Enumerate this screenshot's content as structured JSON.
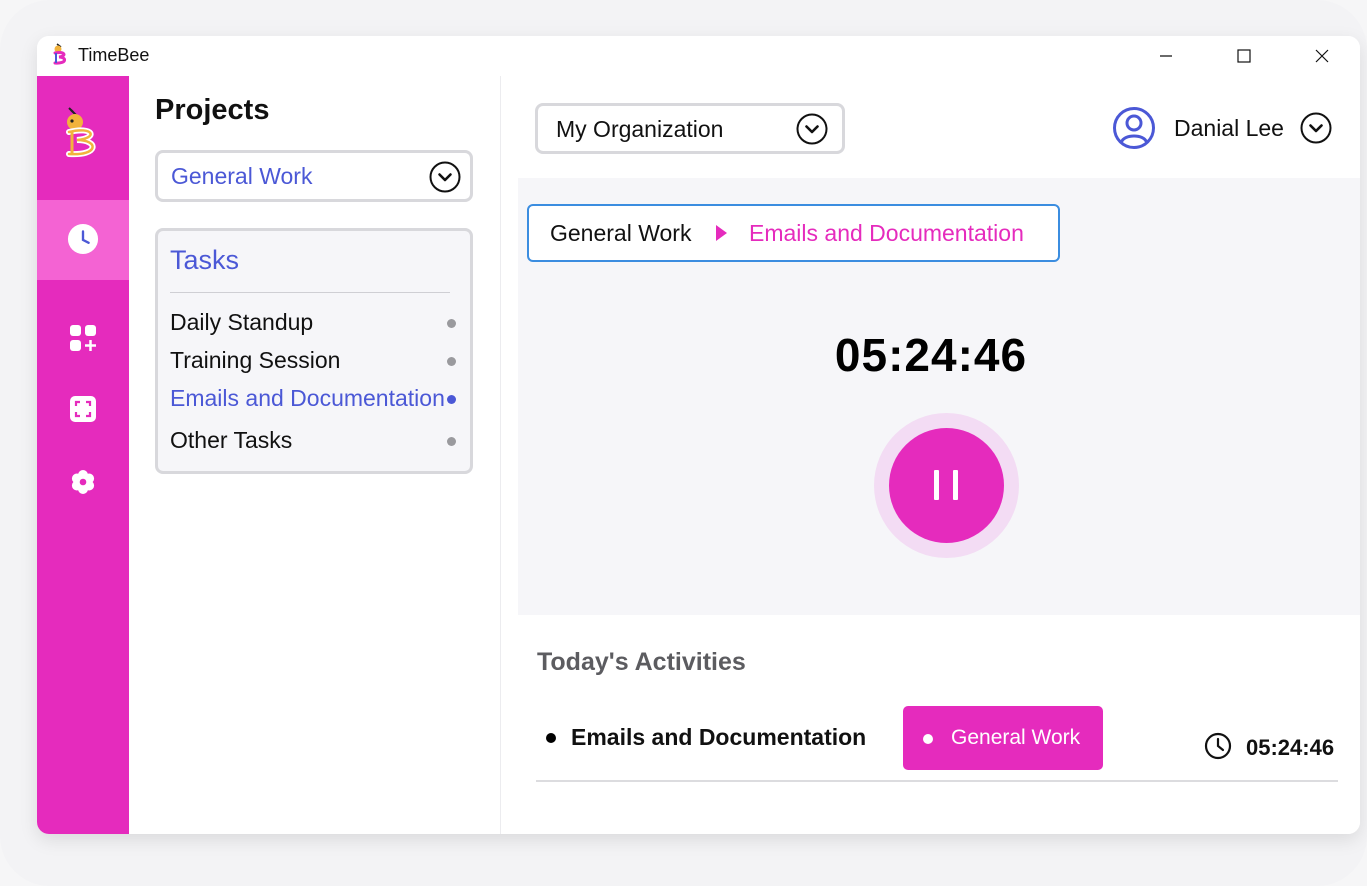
{
  "window": {
    "title": "TimeBee",
    "controls": {
      "minimize": "minimize-icon",
      "maximize": "maximize-icon",
      "close": "close-icon"
    }
  },
  "sidebar": {
    "accent_color": "#e52bbd",
    "active_color": "#f463d3",
    "items": [
      {
        "icon": "clock-icon",
        "active": true
      },
      {
        "icon": "add-widget-icon",
        "active": false
      },
      {
        "icon": "screenshot-icon",
        "active": false
      },
      {
        "icon": "settings-icon",
        "active": false
      }
    ]
  },
  "projects": {
    "title": "Projects",
    "selected_project": "General Work",
    "tasks_heading": "Tasks",
    "tasks": [
      {
        "label": "Daily Standup",
        "active": false
      },
      {
        "label": "Training Session",
        "active": false
      },
      {
        "label": "Emails and Documentation",
        "active": true
      },
      {
        "label": "Other Tasks",
        "active": false
      }
    ]
  },
  "header": {
    "organization": "My Organization",
    "user_name": "Danial Lee"
  },
  "timer": {
    "breadcrumb": {
      "project": "General Work",
      "task": "Emails and Documentation"
    },
    "elapsed": "05:24:46",
    "state": "running"
  },
  "activities": {
    "title": "Today's Activities",
    "items": [
      {
        "task": "Emails and Documentation",
        "project": "General Work",
        "duration": "05:24:46"
      }
    ]
  }
}
